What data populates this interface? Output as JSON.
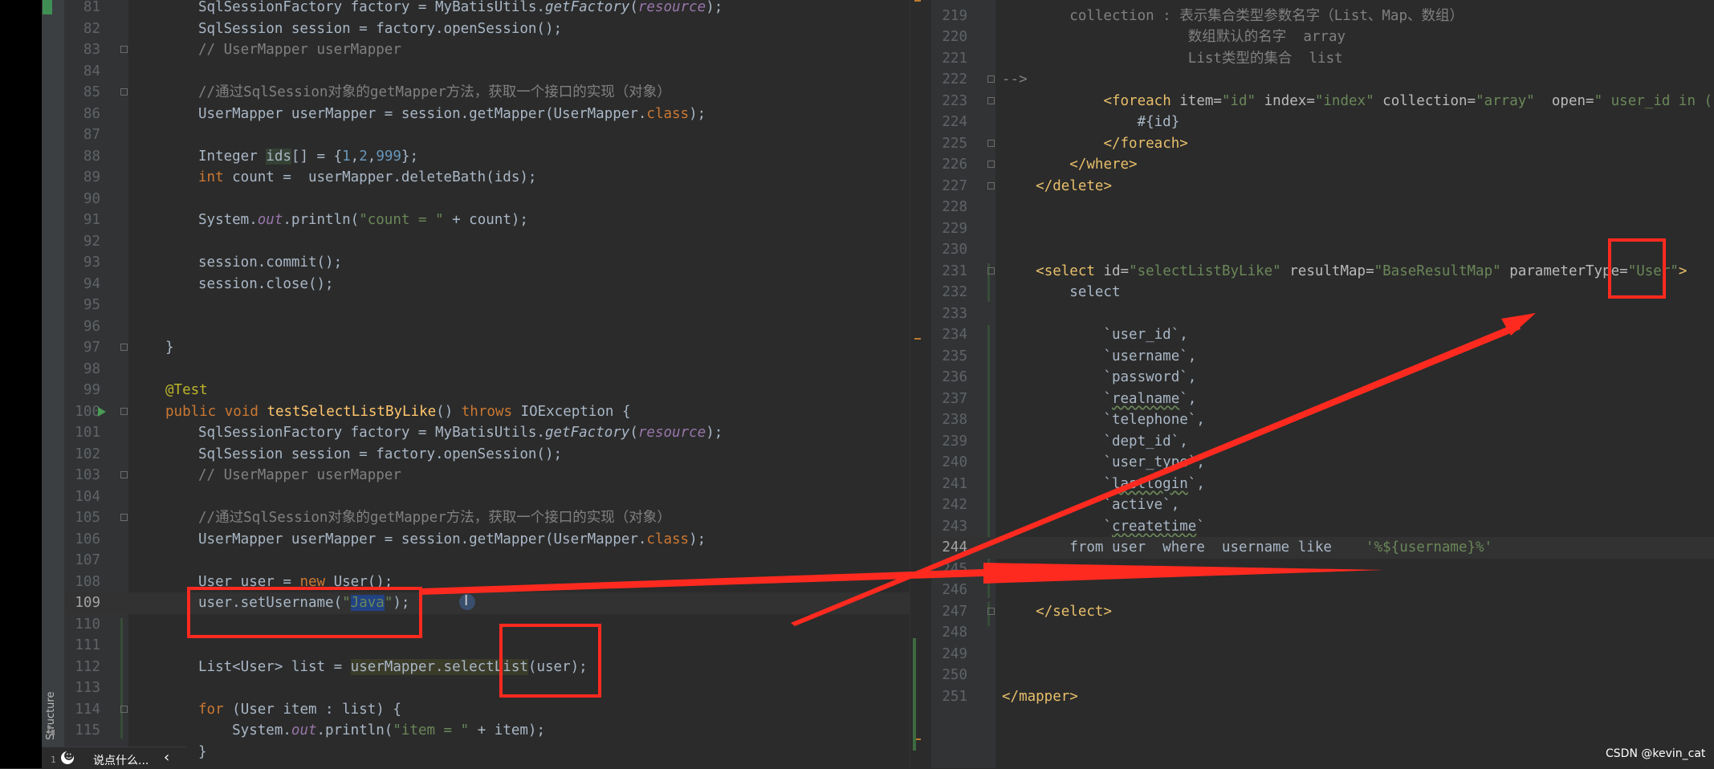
{
  "left_editor": {
    "lines": [
      {
        "n": "81",
        "t": [
          {
            "s": "SqlSessionFactory factory = MyBatisUtils."
          },
          {
            "s": "getFactory",
            "c": "ital"
          },
          {
            "s": "("
          },
          {
            "s": "resource",
            "c": "stat"
          },
          {
            "s": ");"
          }
        ]
      },
      {
        "n": "82",
        "t": [
          {
            "s": "SqlSession session = factory.openSession();"
          }
        ]
      },
      {
        "n": "83",
        "t": [
          {
            "s": "// UserMapper userMapper",
            "c": "cmt"
          }
        ]
      },
      {
        "n": "84",
        "t": []
      },
      {
        "n": "85",
        "t": [
          {
            "s": "//通过SqlSession对象的getMapper方法，获取一个接口的实现（对象）",
            "c": "cmt"
          }
        ]
      },
      {
        "n": "86",
        "t": [
          {
            "s": "UserMapper userMapper = session.getMapper(UserMapper."
          },
          {
            "s": "class",
            "c": "kw"
          },
          {
            "s": ");"
          }
        ]
      },
      {
        "n": "87",
        "t": []
      },
      {
        "n": "88",
        "t": [
          {
            "s": "Integer "
          },
          {
            "s": "ids",
            "c": "hl-var"
          },
          {
            "s": "[] = {"
          },
          {
            "s": "1",
            "c": "num"
          },
          {
            "s": ","
          },
          {
            "s": "2",
            "c": "num"
          },
          {
            "s": ","
          },
          {
            "s": "999",
            "c": "num"
          },
          {
            "s": "};"
          }
        ]
      },
      {
        "n": "89",
        "t": [
          {
            "s": "int",
            "c": "kw"
          },
          {
            "s": " count =  userMapper.deleteBath(ids);"
          }
        ]
      },
      {
        "n": "90",
        "t": []
      },
      {
        "n": "91",
        "t": [
          {
            "s": "System."
          },
          {
            "s": "out",
            "c": "stat"
          },
          {
            "s": ".println("
          },
          {
            "s": "\"count = \"",
            "c": "str"
          },
          {
            "s": " + count);"
          }
        ]
      },
      {
        "n": "92",
        "t": []
      },
      {
        "n": "93",
        "t": [
          {
            "s": "session.commit();"
          }
        ]
      },
      {
        "n": "94",
        "t": [
          {
            "s": "session.close();"
          }
        ]
      },
      {
        "n": "95",
        "t": []
      },
      {
        "n": "96",
        "t": []
      },
      {
        "n": "97",
        "t": [
          {
            "s": "}"
          }
        ]
      },
      {
        "n": "98",
        "t": []
      },
      {
        "n": "99",
        "t": [
          {
            "s": "@Test",
            "c": "ann"
          }
        ]
      },
      {
        "n": "100",
        "t": [
          {
            "s": "public void ",
            "c": "kw"
          },
          {
            "s": "testSelectListByLike",
            "c": "meth"
          },
          {
            "s": "() "
          },
          {
            "s": "throws ",
            "c": "kw"
          },
          {
            "s": "IOException {"
          }
        ]
      },
      {
        "n": "101",
        "t": [
          {
            "s": "SqlSessionFactory factory = MyBatisUtils."
          },
          {
            "s": "getFactory",
            "c": "ital"
          },
          {
            "s": "("
          },
          {
            "s": "resource",
            "c": "stat"
          },
          {
            "s": ");"
          }
        ]
      },
      {
        "n": "102",
        "t": [
          {
            "s": "SqlSession session = factory.openSession();"
          }
        ]
      },
      {
        "n": "103",
        "t": [
          {
            "s": "// UserMapper userMapper",
            "c": "cmt"
          }
        ]
      },
      {
        "n": "104",
        "t": []
      },
      {
        "n": "105",
        "t": [
          {
            "s": "//通过SqlSession对象的getMapper方法，获取一个接口的实现（对象）",
            "c": "cmt"
          }
        ]
      },
      {
        "n": "106",
        "t": [
          {
            "s": "UserMapper userMapper = session.getMapper(UserMapper."
          },
          {
            "s": "class",
            "c": "kw"
          },
          {
            "s": ");"
          }
        ]
      },
      {
        "n": "107",
        "t": []
      },
      {
        "n": "108",
        "t": [
          {
            "s": "User user = "
          },
          {
            "s": "new ",
            "c": "kw"
          },
          {
            "s": "User();"
          }
        ]
      },
      {
        "n": "109",
        "t": [
          {
            "s": "user.setUsername("
          },
          {
            "s": "\"",
            "c": "str"
          },
          {
            "s": "Java",
            "c": "str hl-sel"
          },
          {
            "s": "\"",
            "c": "str"
          },
          {
            "s": ");"
          }
        ]
      },
      {
        "n": "110",
        "t": []
      },
      {
        "n": "111",
        "t": []
      },
      {
        "n": "112",
        "t": [
          {
            "s": "List<User> list = "
          },
          {
            "s": "userMapper.selectList",
            "c": "hl-ok"
          },
          {
            "s": "(user);"
          }
        ]
      },
      {
        "n": "113",
        "t": []
      },
      {
        "n": "114",
        "t": [
          {
            "s": "for ",
            "c": "kw"
          },
          {
            "s": "(User item : list) {"
          }
        ]
      },
      {
        "n": "115",
        "t": [
          {
            "s": "    System."
          },
          {
            "s": "out",
            "c": "stat"
          },
          {
            "s": ".println("
          },
          {
            "s": "\"item = \"",
            "c": "str"
          },
          {
            "s": " + item);"
          }
        ]
      },
      {
        "n": "",
        "t": [
          {
            "s": "}"
          }
        ]
      }
    ]
  },
  "right_editor": {
    "lines": [
      {
        "n": "219",
        "t": [
          {
            "s": "        collection : 表示集合类型参数名字（List、Map、数组）",
            "c": "cmt"
          }
        ]
      },
      {
        "n": "220",
        "t": [
          {
            "s": "                      数组默认的名字  array",
            "c": "cmt"
          }
        ]
      },
      {
        "n": "221",
        "t": [
          {
            "s": "                      List类型的集合  list",
            "c": "cmt"
          }
        ]
      },
      {
        "n": "222",
        "t": [
          {
            "s": "-->",
            "c": "cmt"
          }
        ]
      },
      {
        "n": "223",
        "t": [
          {
            "s": "            "
          },
          {
            "s": "<foreach ",
            "c": "tag"
          },
          {
            "s": "item=",
            "c": "attr"
          },
          {
            "s": "\"id\" ",
            "c": "str"
          },
          {
            "s": "index=",
            "c": "attr"
          },
          {
            "s": "\"index\" ",
            "c": "str"
          },
          {
            "s": "collection=",
            "c": "attr"
          },
          {
            "s": "\"array\"  ",
            "c": "str"
          },
          {
            "s": "open=",
            "c": "attr"
          },
          {
            "s": "\" user_id in ( \"",
            "c": "str"
          }
        ]
      },
      {
        "n": "224",
        "t": [
          {
            "s": "                #{id}"
          }
        ]
      },
      {
        "n": "225",
        "t": [
          {
            "s": "            "
          },
          {
            "s": "</foreach>",
            "c": "tag"
          }
        ]
      },
      {
        "n": "226",
        "t": [
          {
            "s": "        "
          },
          {
            "s": "</where>",
            "c": "tag"
          }
        ]
      },
      {
        "n": "227",
        "t": [
          {
            "s": "    "
          },
          {
            "s": "</delete>",
            "c": "tag"
          }
        ]
      },
      {
        "n": "228",
        "t": []
      },
      {
        "n": "229",
        "t": []
      },
      {
        "n": "230",
        "t": []
      },
      {
        "n": "231",
        "t": [
          {
            "s": "    "
          },
          {
            "s": "<select ",
            "c": "tag"
          },
          {
            "s": "id=",
            "c": "attr"
          },
          {
            "s": "\"selectListByLike\" ",
            "c": "str"
          },
          {
            "s": "resultMap=",
            "c": "attr"
          },
          {
            "s": "\"BaseResultMap\" ",
            "c": "str"
          },
          {
            "s": "parameterType=",
            "c": "attr"
          },
          {
            "s": "\"User\"",
            "c": "str"
          },
          {
            "s": ">",
            "c": "tag"
          }
        ]
      },
      {
        "n": "232",
        "t": [
          {
            "s": "        select"
          }
        ]
      },
      {
        "n": "233",
        "t": []
      },
      {
        "n": "234",
        "t": [
          {
            "s": "            `user_id`,"
          }
        ]
      },
      {
        "n": "235",
        "t": [
          {
            "s": "            `username`,"
          }
        ]
      },
      {
        "n": "236",
        "t": [
          {
            "s": "            `password`,"
          }
        ]
      },
      {
        "n": "237",
        "t": [
          {
            "s": "            `"
          },
          {
            "s": "realname",
            "c": "under"
          },
          {
            "s": "`,"
          }
        ]
      },
      {
        "n": "238",
        "t": [
          {
            "s": "            `telephone`,"
          }
        ]
      },
      {
        "n": "239",
        "t": [
          {
            "s": "            `dept_id`,"
          }
        ]
      },
      {
        "n": "240",
        "t": [
          {
            "s": "            `user_type`,"
          }
        ]
      },
      {
        "n": "241",
        "t": [
          {
            "s": "            `"
          },
          {
            "s": "lastlogin",
            "c": "under"
          },
          {
            "s": "`,"
          }
        ]
      },
      {
        "n": "242",
        "t": [
          {
            "s": "            `active`,"
          }
        ]
      },
      {
        "n": "243",
        "t": [
          {
            "s": "            `"
          },
          {
            "s": "createtime",
            "c": "under"
          },
          {
            "s": "`"
          }
        ]
      },
      {
        "n": "244",
        "t": [
          {
            "s": "        from user  where  username like    "
          },
          {
            "s": "'%${username}%'",
            "c": "str"
          }
        ]
      },
      {
        "n": "245",
        "t": []
      },
      {
        "n": "246",
        "t": []
      },
      {
        "n": "247",
        "t": [
          {
            "s": "    "
          },
          {
            "s": "</select>",
            "c": "tag"
          }
        ]
      },
      {
        "n": "248",
        "t": []
      },
      {
        "n": "249",
        "t": []
      },
      {
        "n": "250",
        "t": []
      },
      {
        "n": "251",
        "t": [
          {
            "s": "</mapper>",
            "c": "tag"
          }
        ]
      }
    ]
  },
  "sidebar": {
    "structure_label": "Structure"
  },
  "comment_bar": {
    "placeholder": "说点什么...",
    "small_label": "1"
  },
  "watermark": "CSDN @kevin_cat"
}
